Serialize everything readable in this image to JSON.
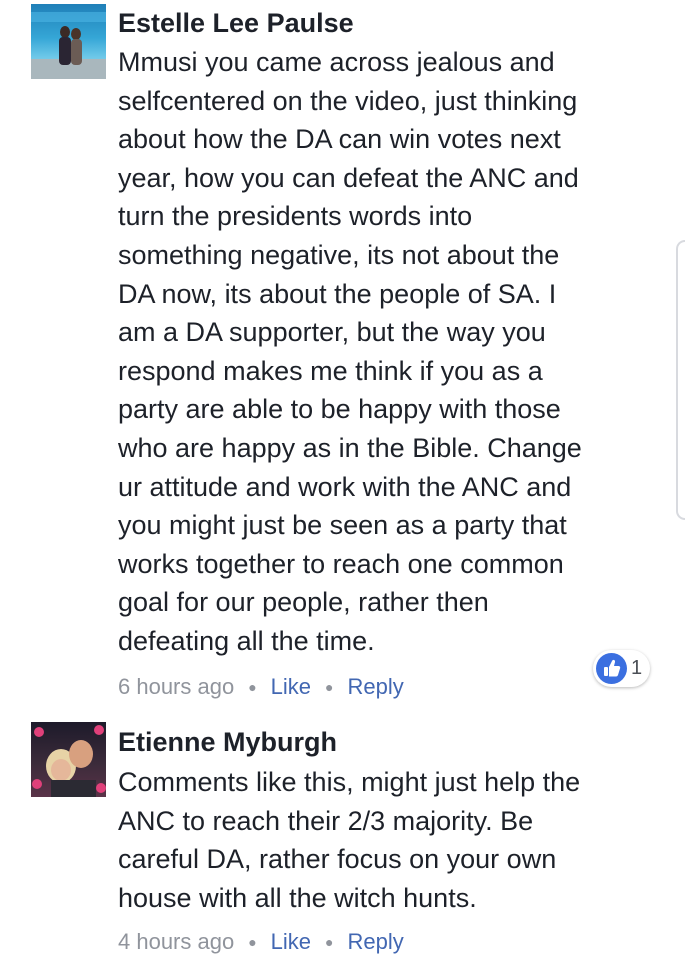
{
  "comments": [
    {
      "author": "Estelle Lee Paulse",
      "text": "Mmusi you came across jealous and\nselfcentered on the video, just thinking\nabout how the DA can win votes next\nyear, how you can defeat the ANC and\nturn the presidents words into\nsomething negative, its not about the\nDA now, its about the people of SA. I\nam a DA supporter, but the way you\nrespond makes me think if you as a\nparty are able to be happy with those\nwho are happy as in the Bible. Change\nur attitude and work with the ANC and\nyou might just be seen as a party that\nworks  together to reach one common\ngoal for our people, rather then\ndefeating all the time.",
      "time": "6 hours ago",
      "like_label": "Like",
      "reply_label": "Reply",
      "reaction": {
        "icon": "thumbs-up-icon",
        "count": "1",
        "color": "#3b6fe0"
      }
    },
    {
      "author": "Etienne Myburgh",
      "text": "Comments like this, might just help the\nANC to reach their 2/3 majority. Be\ncareful DA, rather focus on your own\nhouse with all the witch hunts.",
      "time": "4 hours ago",
      "like_label": "Like",
      "reply_label": "Reply"
    }
  ],
  "colors": {
    "text": "#1d2129",
    "meta": "#90949c",
    "link": "#4267b2"
  }
}
